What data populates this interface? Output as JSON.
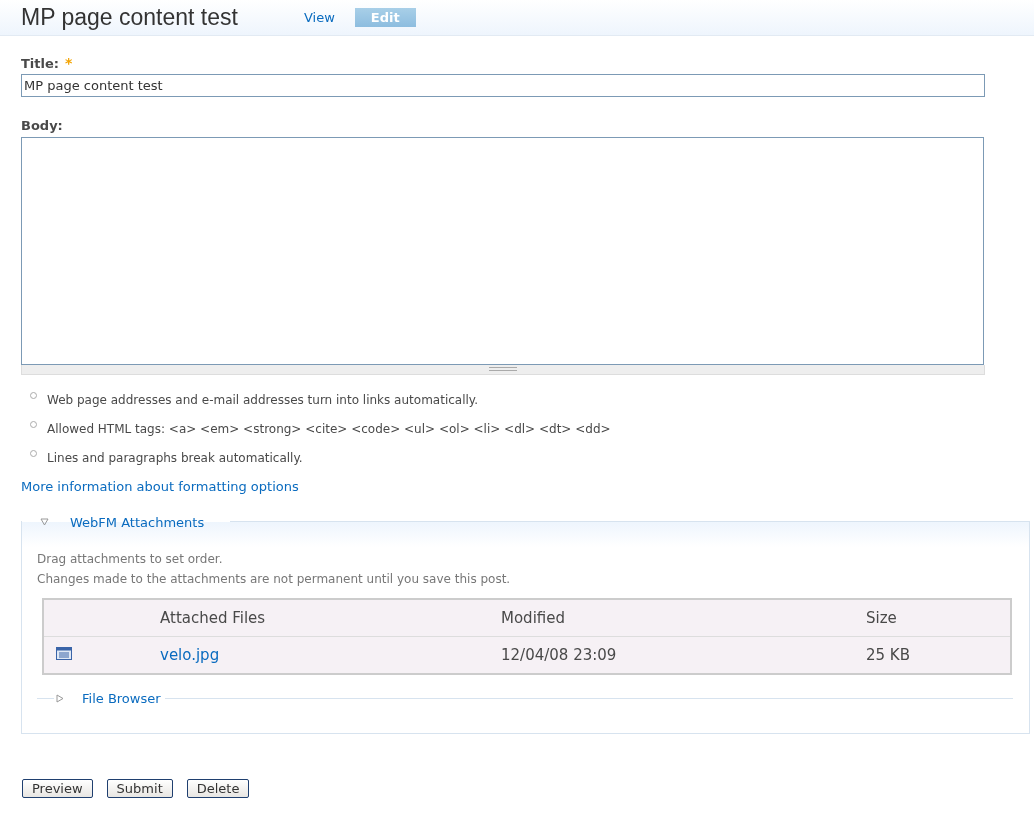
{
  "page_title": "MP page content test",
  "tabs": [
    {
      "label": "View",
      "selected": false
    },
    {
      "label": "Edit",
      "selected": true
    }
  ],
  "title_field": {
    "label": "Title:",
    "required": true,
    "required_mark": "*",
    "value": "MP page content test"
  },
  "body_field": {
    "label": "Body:"
  },
  "format_tips": [
    "Web page addresses and e-mail addresses turn into links automatically.",
    "Allowed HTML tags: <a> <em> <strong> <cite> <code> <ul> <ol> <li> <dl> <dt> <dd>",
    "Lines and paragraphs break automatically."
  ],
  "format_link": "More information about formatting options",
  "attachments": {
    "legend": "WebFM Attachments",
    "expanded": true,
    "help": [
      "Drag attachments to set order.",
      "Changes made to the attachments are not permanent until you save this post."
    ],
    "columns": [
      "Attached Files",
      "Modified",
      "Size"
    ],
    "rows": [
      {
        "name": "velo.jpg",
        "modified": "12/04/08 23:09",
        "size": "25 KB"
      }
    ],
    "sub_fieldset": {
      "legend": "File Browser",
      "expanded": false
    }
  },
  "buttons": [
    "Preview",
    "Submit",
    "Delete"
  ]
}
